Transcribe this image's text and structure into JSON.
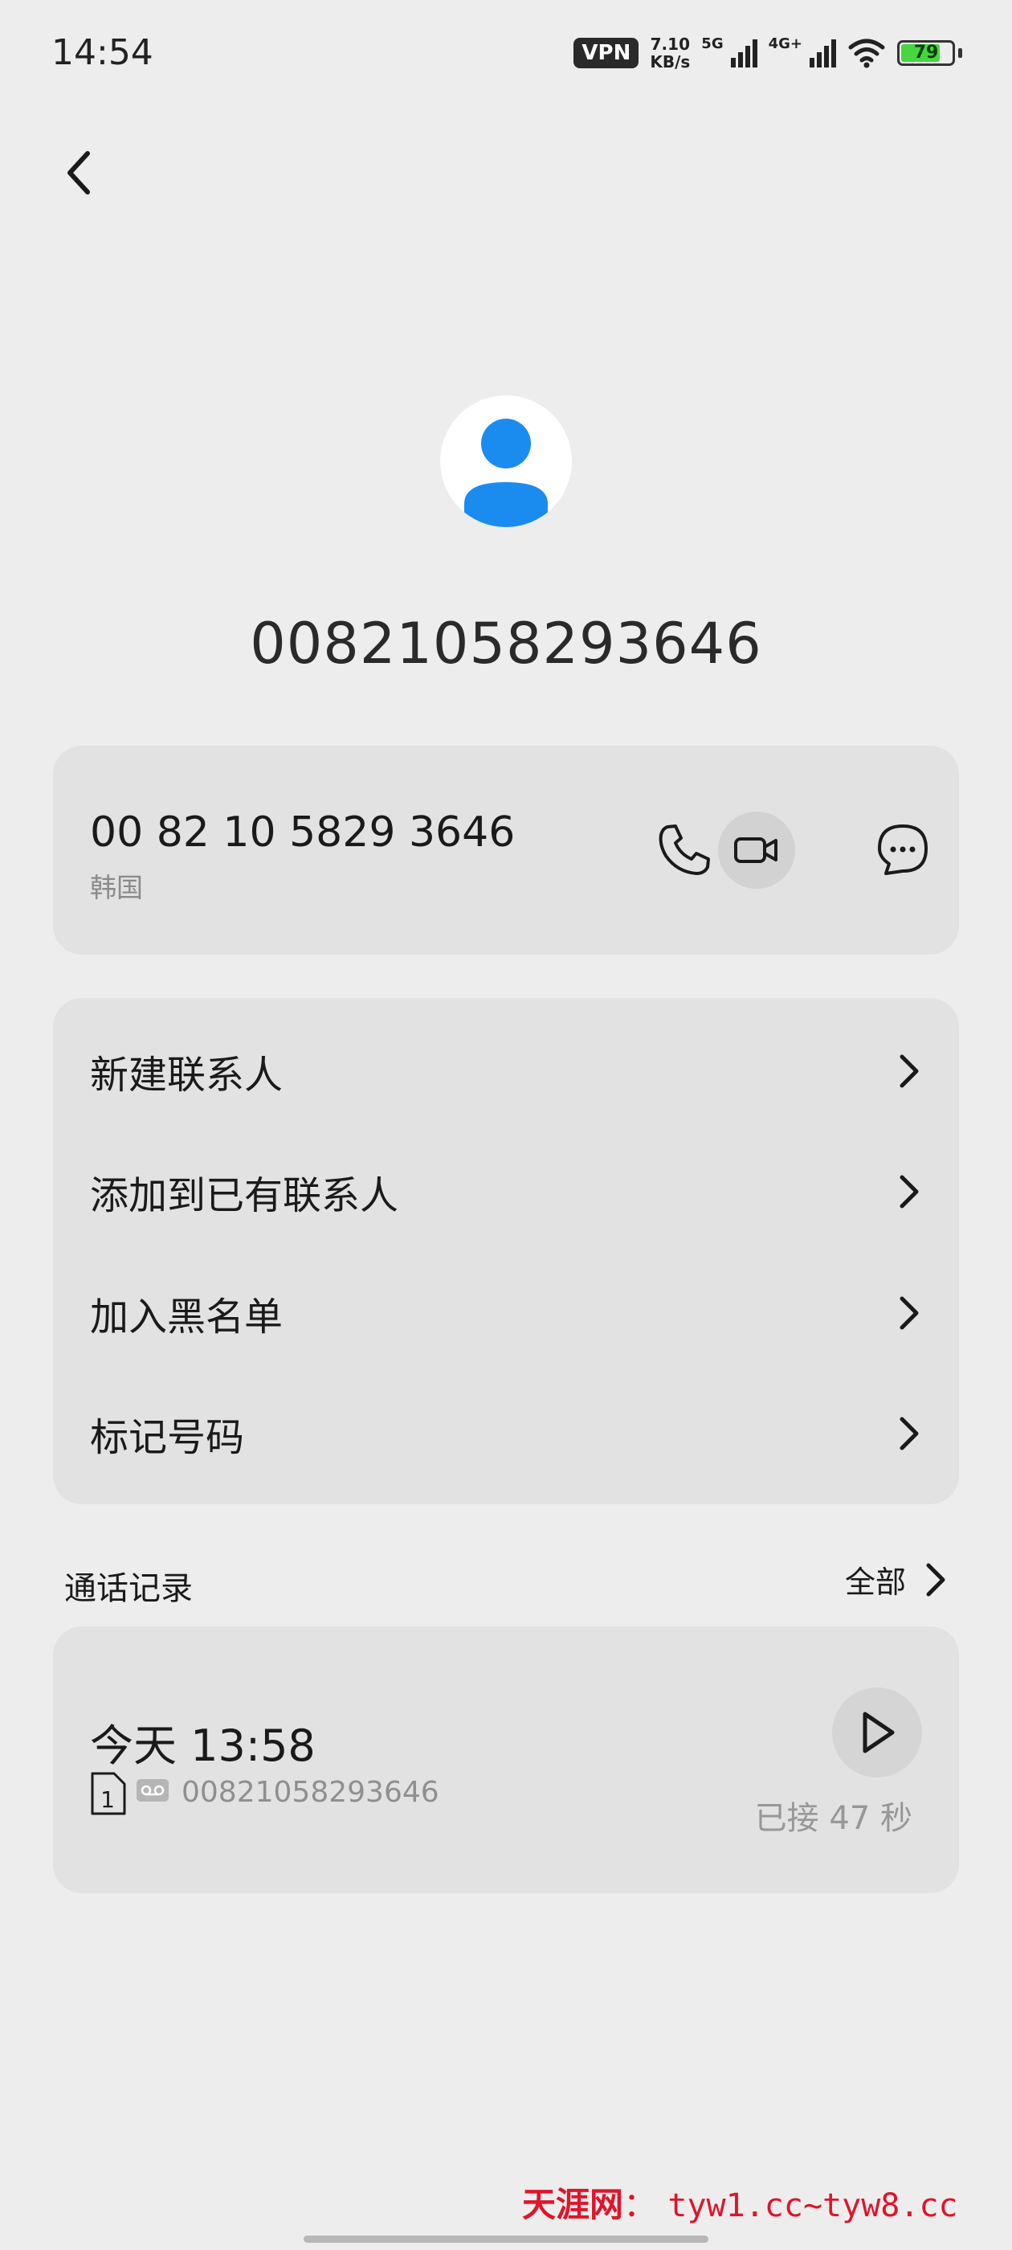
{
  "status_bar": {
    "time": "14:54",
    "vpn": "VPN",
    "speed_value": "7.10",
    "speed_unit": "KB/s",
    "net1": "5G",
    "net2": "4G+",
    "battery": "79",
    "battery_level": 0.79
  },
  "contact": {
    "title": "00821058293646",
    "phone_formatted": "00 82 10 5829 3646",
    "region": "韩国"
  },
  "actions_menu": [
    {
      "label": "新建联系人"
    },
    {
      "label": "添加到已有联系人"
    },
    {
      "label": "加入黑名单"
    },
    {
      "label": "标记号码"
    }
  ],
  "call_log": {
    "section_title": "通话记录",
    "see_all": "全部",
    "entry": {
      "date": "今天 13:58",
      "sim": "1",
      "number": "00821058293646",
      "duration": "已接 47 秒"
    }
  },
  "watermark": {
    "brand": "天涯网",
    "separator": "：",
    "url": "tyw1.cc~tyw8.cc"
  },
  "colors": {
    "accent_blue": "#1a8cf0",
    "background": "#ededed",
    "card": "#e2e2e2",
    "watermark_red": "#e0142a",
    "battery_green": "#45d640"
  }
}
